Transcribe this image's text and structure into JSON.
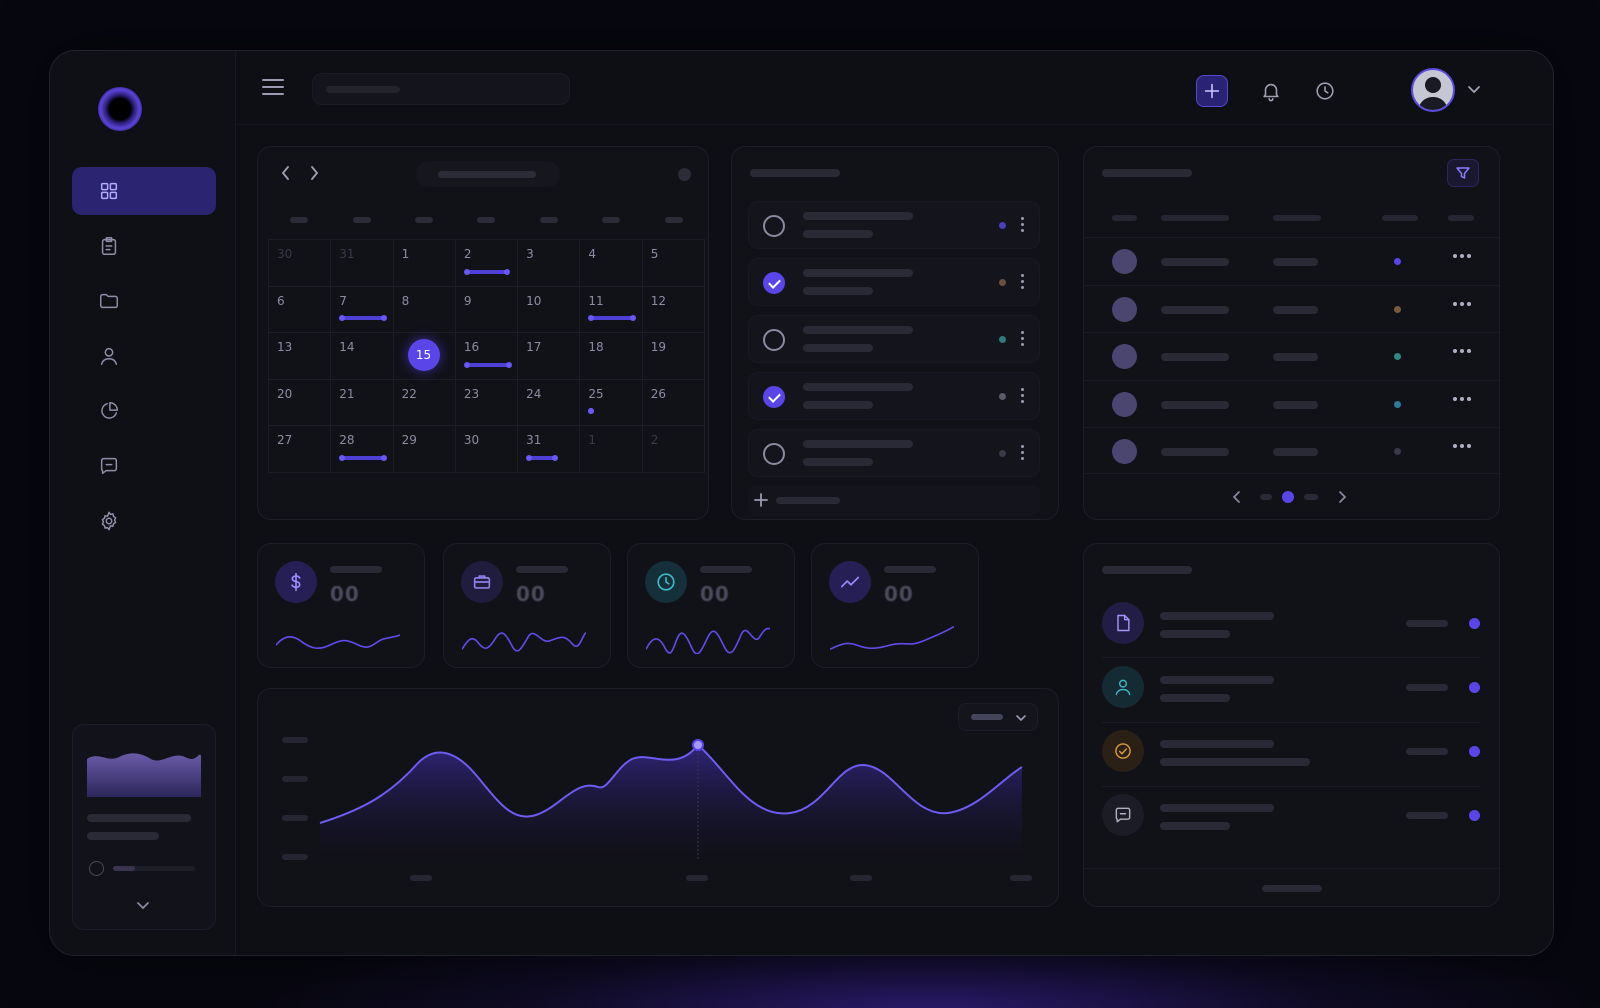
{
  "search": {
    "placeholder": ""
  },
  "calendar": {
    "days": [
      {
        "n": "30",
        "dim": true
      },
      {
        "n": "31",
        "dim": true
      },
      {
        "n": "1"
      },
      {
        "n": "2",
        "ev": 44
      },
      {
        "n": "3"
      },
      {
        "n": "4"
      },
      {
        "n": "5"
      },
      {
        "n": "6"
      },
      {
        "n": "7",
        "ev": 46
      },
      {
        "n": "8"
      },
      {
        "n": "9"
      },
      {
        "n": "10"
      },
      {
        "n": "11",
        "ev": 46
      },
      {
        "n": "12"
      },
      {
        "n": "13"
      },
      {
        "n": "14"
      },
      {
        "n": "15",
        "today": true
      },
      {
        "n": "16",
        "ev": 46
      },
      {
        "n": "17"
      },
      {
        "n": "18"
      },
      {
        "n": "19"
      },
      {
        "n": "20"
      },
      {
        "n": "21"
      },
      {
        "n": "22"
      },
      {
        "n": "23"
      },
      {
        "n": "24"
      },
      {
        "n": "25",
        "ev": 4
      },
      {
        "n": "26"
      },
      {
        "n": "27"
      },
      {
        "n": "28",
        "ev": 46
      },
      {
        "n": "29"
      },
      {
        "n": "30"
      },
      {
        "n": "31",
        "ev": 30
      },
      {
        "n": "1",
        "dim": true
      },
      {
        "n": "2",
        "dim": true
      }
    ]
  },
  "tasks": [
    {
      "checked": false,
      "color": "#4a3fb8"
    },
    {
      "checked": true,
      "color": "#6b5040"
    },
    {
      "checked": false,
      "color": "#2f7a7a"
    },
    {
      "checked": true,
      "color": "#5a5a68"
    },
    {
      "checked": false,
      "color": "#3a3a48"
    }
  ],
  "table": {
    "rows": [
      {
        "color": "#5a45e8"
      },
      {
        "color": "#7a5a3a"
      },
      {
        "color": "#2e8a84"
      },
      {
        "color": "#2f7a9a"
      },
      {
        "color": "#3a3a48"
      }
    ]
  },
  "stats": [
    {
      "value": "00",
      "icon": "dollar-icon",
      "color": "#9c8cff",
      "bg": "#261f55"
    },
    {
      "value": "00",
      "icon": "briefcase-icon",
      "color": "#8f7fe6",
      "bg": "#1f1c3e"
    },
    {
      "value": "00",
      "icon": "clock-icon",
      "color": "#3fb8c8",
      "bg": "#15303a"
    },
    {
      "value": "00",
      "icon": "trend-up-icon",
      "color": "#9c8cff",
      "bg": "#261f55"
    }
  ],
  "colors": {
    "accent": "#5a45e8",
    "background": "#0e0e15",
    "panel": "#111118"
  }
}
